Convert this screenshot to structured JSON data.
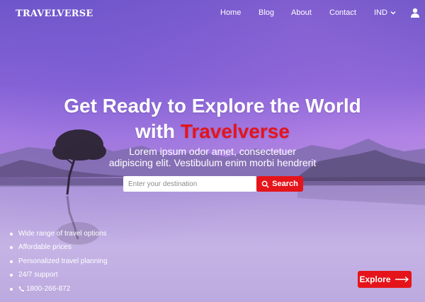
{
  "nav": {
    "logo": "TRAVELVERSE",
    "links": [
      "Home",
      "Blog",
      "About",
      "Contact"
    ],
    "currency": "IND",
    "icons": {
      "currency": "chevron-down-icon",
      "account": "user-icon"
    }
  },
  "hero": {
    "title_line1": "Get Ready to Explore the World",
    "title_line2_prefix": "with ",
    "title_line2_brand": "Travelverse",
    "subtitle_line1": "Lorem ipsum odor amet, consectetuer",
    "subtitle_line2": "adipiscing elit. Vestibulum enim morbi hendrerit"
  },
  "search": {
    "placeholder": "Enter your destination",
    "value": "",
    "button_label": "Search",
    "button_icon": "search-icon"
  },
  "features": [
    "Wide range of travel options",
    "Affordable prices",
    "Personalized travel planning",
    "24/7 support",
    "1800-266-872"
  ],
  "explore": {
    "label": "Explore",
    "icon": "arrow-right-icon"
  },
  "colors": {
    "accent": "#e5141b",
    "sky_top": "#6a54c6",
    "sky_horizon": "#b184e6",
    "water": "#c7b6e6"
  }
}
